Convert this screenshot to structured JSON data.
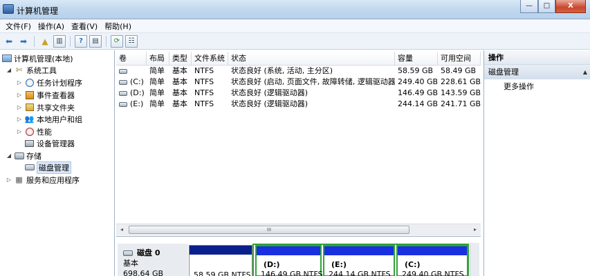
{
  "window": {
    "title": "计算机管理",
    "minimize_glyph": "—",
    "maximize_glyph": "□",
    "close_glyph": "X"
  },
  "menu": [
    {
      "label": "文件(F)"
    },
    {
      "label": "操作(A)"
    },
    {
      "label": "查看(V)"
    },
    {
      "label": "帮助(H)"
    }
  ],
  "toolbar": {
    "icons": [
      "back-arrow-icon",
      "forward-arrow-icon",
      "up-folder-icon",
      "show-hide-tree-icon",
      "help-icon",
      "show-hide-action-pane-icon",
      "refresh-icon",
      "properties-icon"
    ]
  },
  "tree": {
    "root": {
      "label": "计算机管理(本地)"
    },
    "system_tools": {
      "label": "系统工具",
      "toggle": "◢"
    },
    "task_scheduler": {
      "label": "任务计划程序",
      "toggle": "▷"
    },
    "event_viewer": {
      "label": "事件查看器",
      "toggle": "▷"
    },
    "shared_folders": {
      "label": "共享文件夹",
      "toggle": "▷"
    },
    "local_users": {
      "label": "本地用户和组",
      "toggle": "▷"
    },
    "performance": {
      "label": "性能",
      "toggle": "▷"
    },
    "device_manager": {
      "label": "设备管理器"
    },
    "storage": {
      "label": "存储",
      "toggle": "◢"
    },
    "disk_management": {
      "label": "磁盘管理"
    },
    "services_apps": {
      "label": "服务和应用程序",
      "toggle": "▷"
    }
  },
  "volumes": {
    "columns": [
      "卷",
      "布局",
      "类型",
      "文件系统",
      "状态",
      "容量",
      "可用空间"
    ],
    "rows": [
      {
        "volume": "",
        "layout": "简单",
        "type": "基本",
        "fs": "NTFS",
        "status": "状态良好 (系统, 活动, 主分区)",
        "capacity": "58.59 GB",
        "free": "58.49 GB"
      },
      {
        "volume": "(C:)",
        "layout": "简单",
        "type": "基本",
        "fs": "NTFS",
        "status": "状态良好 (启动, 页面文件, 故障转储, 逻辑驱动器)",
        "capacity": "249.40 GB",
        "free": "228.61 GB"
      },
      {
        "volume": "(D:)",
        "layout": "简单",
        "type": "基本",
        "fs": "NTFS",
        "status": "状态良好 (逻辑驱动器)",
        "capacity": "146.49 GB",
        "free": "143.59 GB"
      },
      {
        "volume": "(E:)",
        "layout": "简单",
        "type": "基本",
        "fs": "NTFS",
        "status": "状态良好 (逻辑驱动器)",
        "capacity": "244.14 GB",
        "free": "241.71 GB"
      }
    ]
  },
  "scrollbar": {
    "left": "◂",
    "right": "▸",
    "grip": "III"
  },
  "disk": {
    "name": "磁盘 0",
    "type": "基本",
    "size": "698.64 GB",
    "partitions": [
      {
        "name": "",
        "size": "58.59 GB NTFS"
      },
      {
        "name": "(D:)",
        "size": "146.49 GB NTFS"
      },
      {
        "name": "(E:)",
        "size": "244.14 GB NTFS"
      },
      {
        "name": "(C:)",
        "size": "249.40 GB NTFS"
      }
    ]
  },
  "actions": {
    "header": "操作",
    "section": "磁盘管理",
    "section_arrow": "▲",
    "more": "更多操作"
  },
  "colors": {
    "primary_partition": "#0a1f8c",
    "logical_drive": "#1a2fe0",
    "extended_partition": "#2fa33a"
  }
}
